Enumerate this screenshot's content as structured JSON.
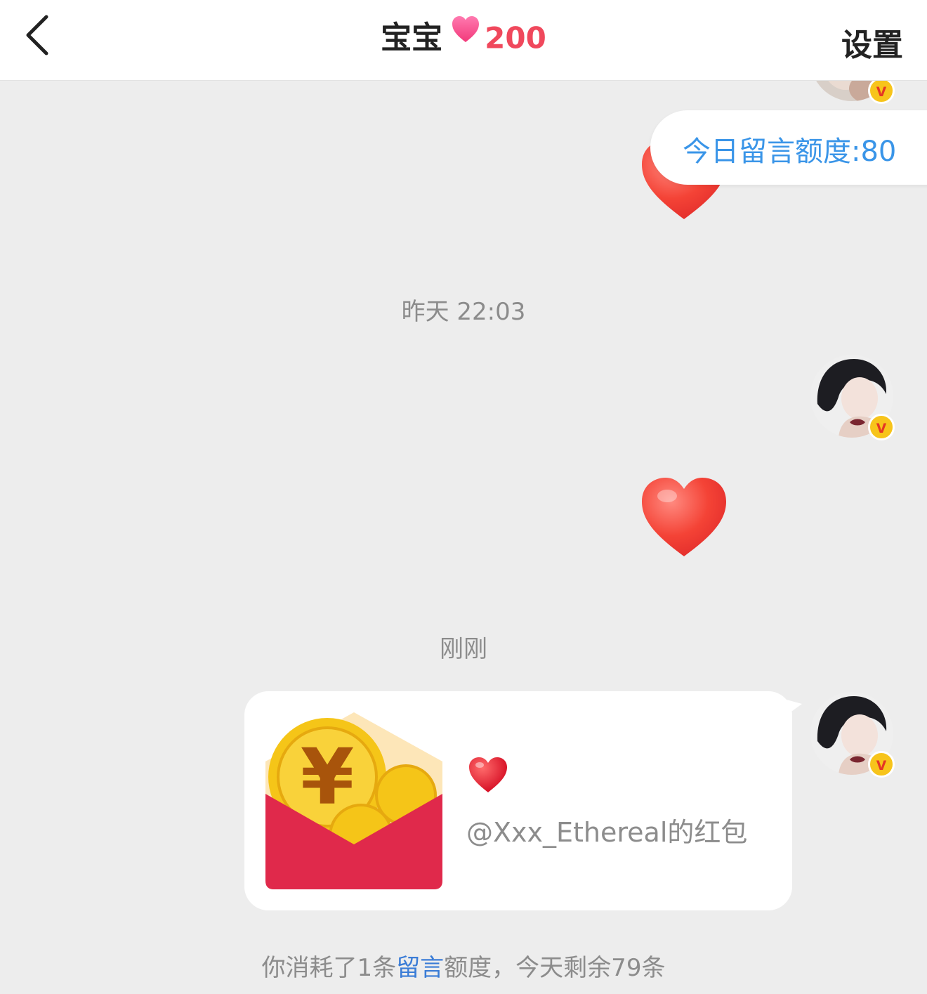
{
  "header": {
    "title": "宝宝",
    "intimacy_value": "200",
    "settings_label": "设置",
    "back_icon": "chevron-left-icon",
    "heart_icon": "heart-icon"
  },
  "quota_pill": {
    "text": "今日留言额度:80"
  },
  "messages": {
    "time_1": "昨天 22:03",
    "time_2": "刚刚",
    "red_packet": {
      "emoji": "❤️",
      "from_text": "@Xxx_Ethereal的红包"
    }
  },
  "notice": {
    "part1": "你消耗了1条",
    "link_text": "留言",
    "part2": "额度，今天剩余79条"
  },
  "colors": {
    "accent_pink": "#f0485c",
    "link_blue": "#3a95e8",
    "red_packet": "#e0294b",
    "coin": "#f5c518"
  }
}
